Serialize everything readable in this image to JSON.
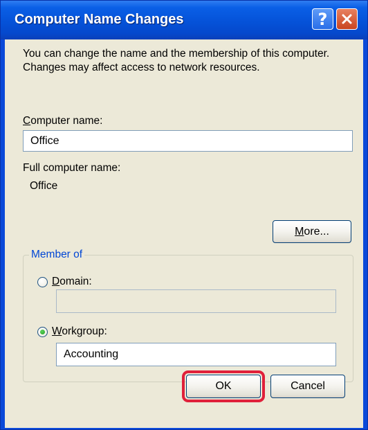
{
  "window": {
    "title": "Computer Name Changes",
    "help_label": "?",
    "close_label": "✕"
  },
  "intro_text": "You can change the name and the membership of this computer. Changes may affect access to network resources.",
  "computer_name": {
    "label_accel": "C",
    "label_rest": "omputer name:",
    "value": "Office"
  },
  "full_computer_name": {
    "label": "Full computer name:",
    "value": "Office"
  },
  "more_button": {
    "accel": "M",
    "rest": "ore..."
  },
  "member_of": {
    "legend": "Member of",
    "domain": {
      "label_accel": "D",
      "label_rest": "omain:",
      "value": "",
      "selected": false
    },
    "workgroup": {
      "label_accel": "W",
      "label_rest": "orkgroup:",
      "value": "Accounting",
      "selected": true
    }
  },
  "buttons": {
    "ok": "OK",
    "cancel": "Cancel"
  },
  "colors": {
    "title_bar": "#0552d8",
    "dialog_face": "#ece9d8",
    "group_legend": "#0046d5",
    "highlight": "#e0203a"
  }
}
